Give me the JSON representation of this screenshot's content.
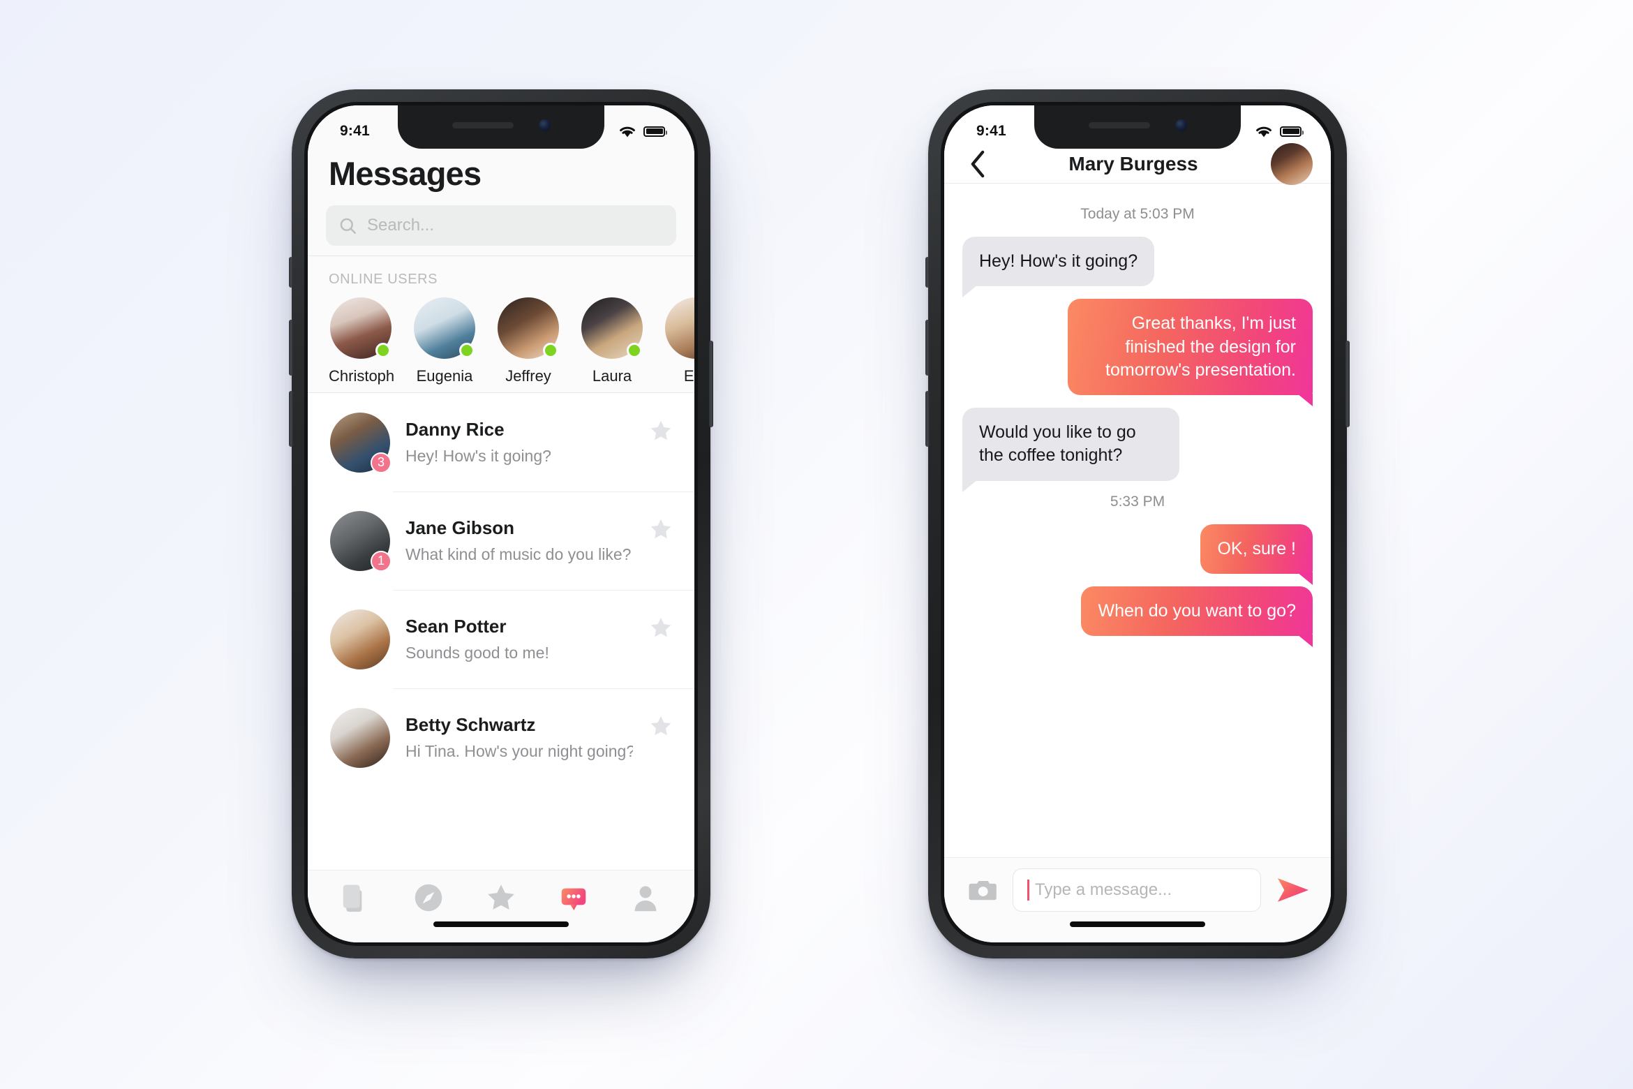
{
  "background": {
    "accent_pink": "#f2447d",
    "accent_orange": "#fb8a63",
    "online_green": "#7ed321",
    "badge_pink": "#f2738c"
  },
  "left_phone": {
    "status_bar": {
      "time": "9:41",
      "wifi_icon": "wifi-icon",
      "battery_icon": "battery-full-icon"
    },
    "header": {
      "title": "Messages"
    },
    "search": {
      "placeholder": "Search...",
      "value": "",
      "icon": "search-icon"
    },
    "online_section": {
      "label": "ONLINE USERS",
      "users": [
        {
          "name": "Christoph",
          "status": "online"
        },
        {
          "name": "Eugenia",
          "status": "online"
        },
        {
          "name": "Jeffrey",
          "status": "online"
        },
        {
          "name": "Laura",
          "status": "online"
        },
        {
          "name": "Ear",
          "status": "online"
        }
      ]
    },
    "threads": [
      {
        "name": "Danny Rice",
        "snippet": "Hey! How's it going?",
        "unread": "3",
        "starred": false
      },
      {
        "name": "Jane Gibson",
        "snippet": "What kind of music do you like?",
        "unread": "1",
        "starred": false
      },
      {
        "name": "Sean Potter",
        "snippet": "Sounds good to me!",
        "unread": "",
        "starred": false
      },
      {
        "name": "Betty Schwartz",
        "snippet": "Hi Tina. How's your night going?",
        "unread": "",
        "starred": false
      }
    ],
    "tabbar": [
      {
        "icon": "cards-stack-icon",
        "label": "Cards",
        "active": false
      },
      {
        "icon": "compass-icon",
        "label": "Discover",
        "active": false
      },
      {
        "icon": "star-icon",
        "label": "Favorites",
        "active": false
      },
      {
        "icon": "chat-bubble-icon",
        "label": "Messages",
        "active": true
      },
      {
        "icon": "person-icon",
        "label": "Profile",
        "active": false
      }
    ]
  },
  "right_phone": {
    "status_bar": {
      "time": "9:41",
      "wifi_icon": "wifi-icon",
      "battery_icon": "battery-full-icon"
    },
    "header": {
      "back_icon": "chevron-left-icon",
      "contact_name": "Mary Burgess",
      "avatar": "contact-avatar"
    },
    "conversation": [
      {
        "kind": "timestamp",
        "text": "Today at 5:03 PM"
      },
      {
        "kind": "message",
        "direction": "in",
        "text": "Hey! How's it going?"
      },
      {
        "kind": "message",
        "direction": "out",
        "text": "Great thanks, I'm just finished the design for tomorrow's presentation."
      },
      {
        "kind": "message",
        "direction": "in",
        "text": "Would you like to go the coffee tonight?"
      },
      {
        "kind": "timestamp",
        "text": "5:33 PM"
      },
      {
        "kind": "message",
        "direction": "out",
        "text": "OK, sure !"
      },
      {
        "kind": "message",
        "direction": "out",
        "text": "When do you want to go?"
      }
    ],
    "input_bar": {
      "camera_icon": "camera-icon",
      "placeholder": "Type a message...",
      "value": "",
      "send_icon": "send-arrow-icon"
    }
  }
}
